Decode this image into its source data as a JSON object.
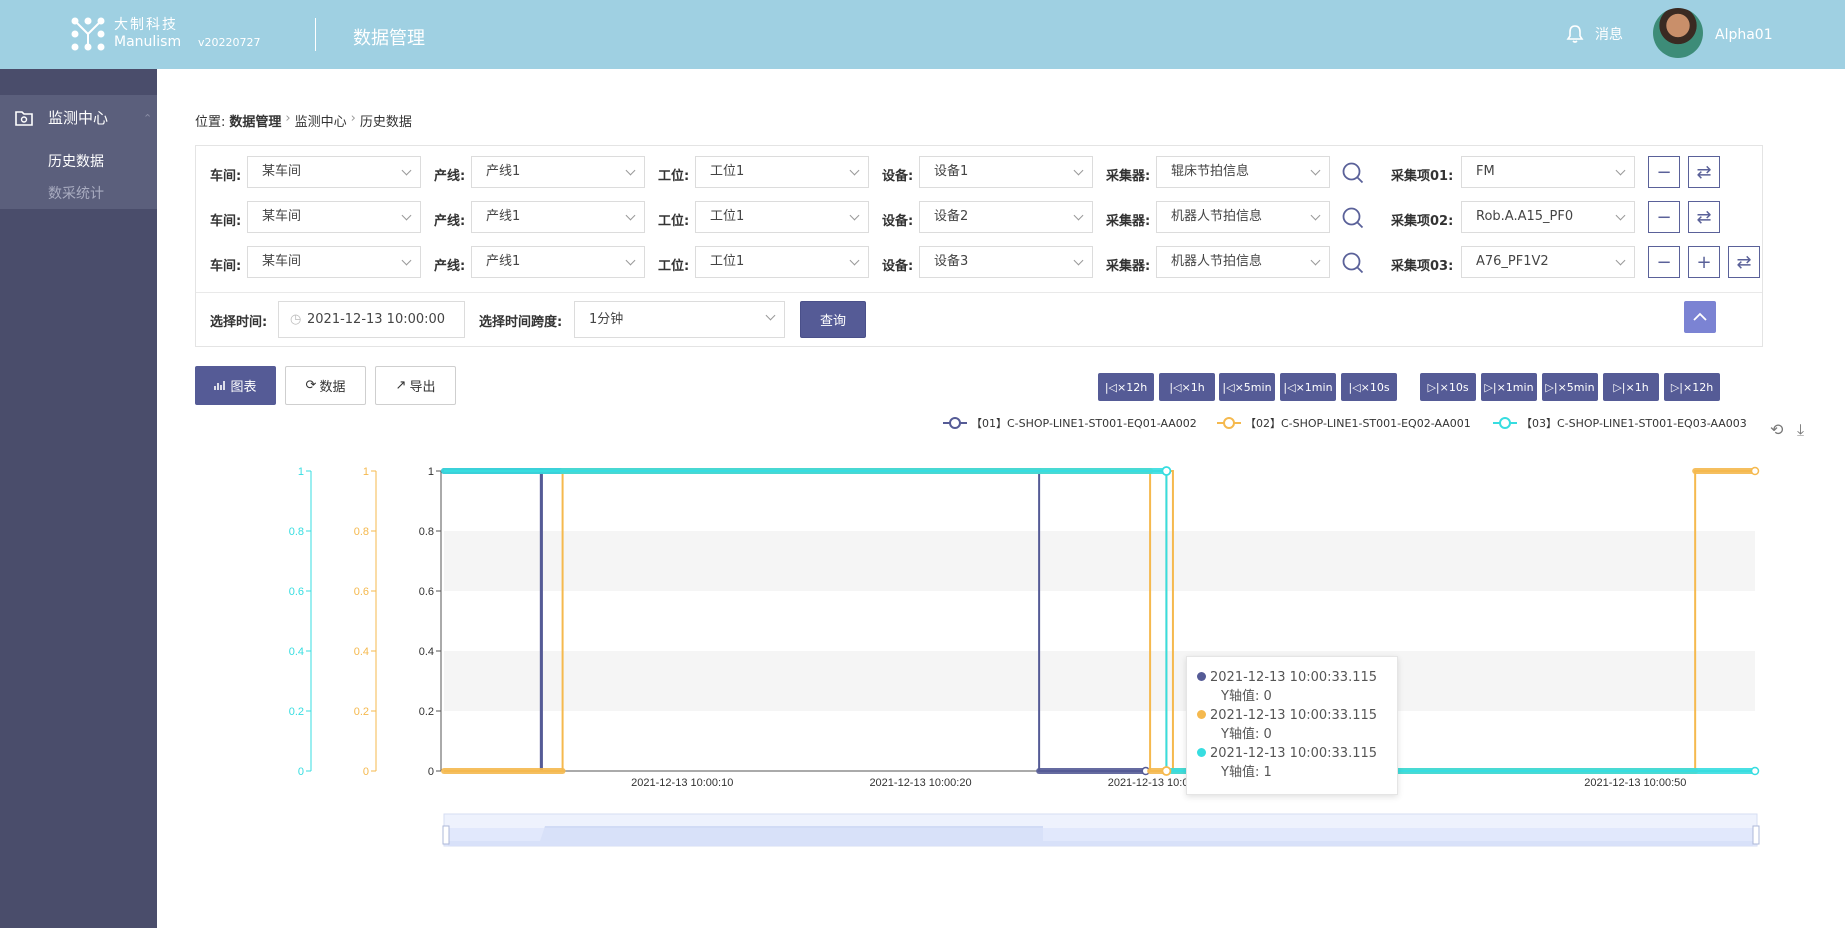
{
  "header": {
    "logo_cn": "大制科技",
    "logo_en": "Manulism",
    "version": "v20220727",
    "system_title": "数据管理",
    "messages_label": "消息",
    "username": "Alpha01"
  },
  "sidebar": {
    "group_label": "监测中心",
    "items": [
      {
        "label": "历史数据",
        "active": true
      },
      {
        "label": "数采统计",
        "active": false
      }
    ]
  },
  "breadcrumb": {
    "prefix": "位置:",
    "items": [
      "数据管理",
      "监测中心",
      "历史数据"
    ]
  },
  "filters": {
    "labels": {
      "workshop": "车间:",
      "line": "产线:",
      "station": "工位:",
      "device": "设备:",
      "collector": "采集器:"
    },
    "rows": [
      {
        "workshop": "某车间",
        "line": "产线1",
        "station": "工位1",
        "device": "设备1",
        "collector": "辊床节拍信息",
        "item_label": "采集项01:",
        "item": "FM"
      },
      {
        "workshop": "某车间",
        "line": "产线1",
        "station": "工位1",
        "device": "设备2",
        "collector": "机器人节拍信息",
        "item_label": "采集项02:",
        "item": "Rob.A.A15_PF0"
      },
      {
        "workshop": "某车间",
        "line": "产线1",
        "station": "工位1",
        "device": "设备3",
        "collector": "机器人节拍信息",
        "item_label": "采集项03:",
        "item": "A76_PF1V2"
      }
    ],
    "time_label": "选择时间:",
    "time_value": "2021-12-13 10:00:00",
    "span_label": "选择时间跨度:",
    "span_value": "1分钟",
    "query_label": "查询"
  },
  "view_tabs": [
    {
      "label": "图表",
      "active": true
    },
    {
      "label": "数据",
      "active": false
    },
    {
      "label": "导出",
      "active": false
    }
  ],
  "time_nav": {
    "back": [
      "×12h",
      "×1h",
      "×5min",
      "×1min",
      "×10s"
    ],
    "forward": [
      "×10s",
      "×1min",
      "×5min",
      "×1h",
      "×12h"
    ]
  },
  "colors": {
    "header_bg": "#9fd0e2",
    "sidebar_bg": "#4a4d6b",
    "primary": "#555b96",
    "series1": "#555b96",
    "series2": "#f5b94e",
    "series3": "#37dde0"
  },
  "chart_data": {
    "type": "line",
    "legend_position": "top-right",
    "series": [
      {
        "name": "【01】C-SHOP-LINE1-ST001-EQ01-AA002",
        "color": "#555b96",
        "points": [
          [
            0,
            1
          ],
          [
            8.9,
            1
          ],
          [
            8.9,
            0
          ],
          [
            9.0,
            0
          ],
          [
            9.0,
            1
          ],
          [
            54.7,
            1
          ],
          [
            54.7,
            0
          ],
          [
            64.5,
            0
          ]
        ]
      },
      {
        "name": "【02】C-SHOP-LINE1-ST001-EQ02-AA001",
        "color": "#f5b94e",
        "points": [
          [
            0,
            0
          ],
          [
            10.9,
            0
          ],
          [
            10.9,
            1
          ],
          [
            64.9,
            1
          ],
          [
            64.9,
            0
          ],
          [
            66.4,
            0
          ],
          [
            66.4,
            1
          ],
          [
            67.0,
            1
          ],
          [
            67.0,
            0
          ],
          [
            115.0,
            0
          ],
          [
            115.0,
            1
          ],
          [
            120.5,
            1
          ]
        ]
      },
      {
        "name": "【03】C-SHOP-LINE1-ST001-EQ03-AA003",
        "color": "#37dde0",
        "points": [
          [
            0,
            1
          ],
          [
            66.4,
            1
          ],
          [
            66.4,
            0
          ],
          [
            120.5,
            0
          ]
        ]
      }
    ],
    "x_ticks": [
      "2021-12-13 10:00:10",
      "2021-12-13 10:00:20",
      "2021-12-13 10:00:30",
      "2021-12-13 10:00:50"
    ],
    "y_ticks": [
      "0",
      "0.2",
      "0.4",
      "0.6",
      "0.8",
      "1"
    ],
    "ylim": [
      0,
      1
    ],
    "tooltip": [
      {
        "color": "#555b96",
        "time": "2021-12-13 10:00:33.115",
        "value": "Y轴值: 0"
      },
      {
        "color": "#f5b94e",
        "time": "2021-12-13 10:00:33.115",
        "value": "Y轴值: 0"
      },
      {
        "color": "#37dde0",
        "time": "2021-12-13 10:00:33.115",
        "value": "Y轴值: 1"
      }
    ]
  }
}
